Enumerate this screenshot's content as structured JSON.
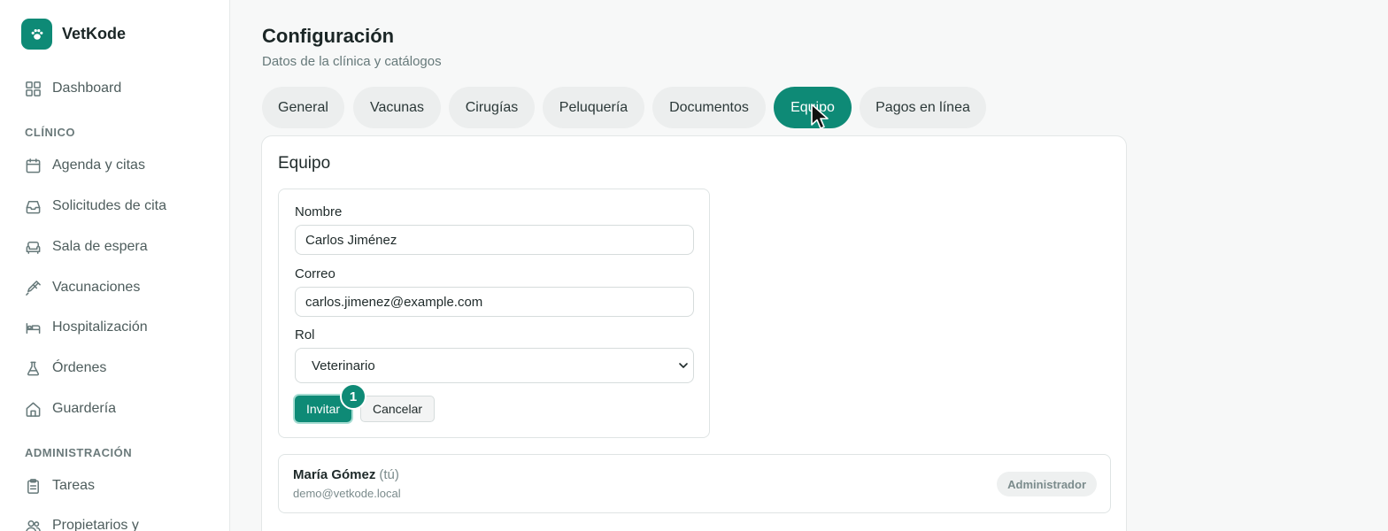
{
  "brand": {
    "name": "VetKode",
    "logo_icon": "paw-icon",
    "color": "#0e8a76"
  },
  "sidebar": {
    "dashboard": {
      "label": "Dashboard",
      "icon": "grid-icon"
    },
    "sections": [
      {
        "label": "CLÍNICO"
      },
      {
        "label": "ADMINISTRACIÓN"
      }
    ],
    "items": [
      {
        "label": "Agenda y citas",
        "icon": "calendar-icon"
      },
      {
        "label": "Solicitudes de cita",
        "icon": "inbox-icon"
      },
      {
        "label": "Sala de espera",
        "icon": "sofa-icon"
      },
      {
        "label": "Vacunaciones",
        "icon": "syringe-icon"
      },
      {
        "label": "Hospitalización",
        "icon": "bed-icon"
      },
      {
        "label": "Órdenes",
        "icon": "flask-icon"
      },
      {
        "label": "Guardería",
        "icon": "home-icon"
      },
      {
        "label": "Tareas",
        "icon": "clipboard-icon"
      },
      {
        "label": "Propietarios y",
        "icon": "users-icon"
      }
    ]
  },
  "header": {
    "title": "Configuración",
    "subtitle": "Datos de la clínica y catálogos"
  },
  "tabs": [
    {
      "label": "General"
    },
    {
      "label": "Vacunas"
    },
    {
      "label": "Cirugías"
    },
    {
      "label": "Peluquería"
    },
    {
      "label": "Documentos"
    },
    {
      "label": "Equipo",
      "active": true
    },
    {
      "label": "Pagos en línea"
    }
  ],
  "team": {
    "title": "Equipo",
    "form": {
      "name_label": "Nombre",
      "name_value": "Carlos Jiménez",
      "email_label": "Correo",
      "email_value": "carlos.jimenez@example.com",
      "role_label": "Rol",
      "role_value": "Veterinario",
      "invite_label": "Invitar",
      "cancel_label": "Cancelar",
      "step_badge": "1"
    },
    "members": [
      {
        "name": "María Gómez",
        "you": "(tú)",
        "email": "demo@vetkode.local",
        "role": "Administrador"
      }
    ]
  }
}
